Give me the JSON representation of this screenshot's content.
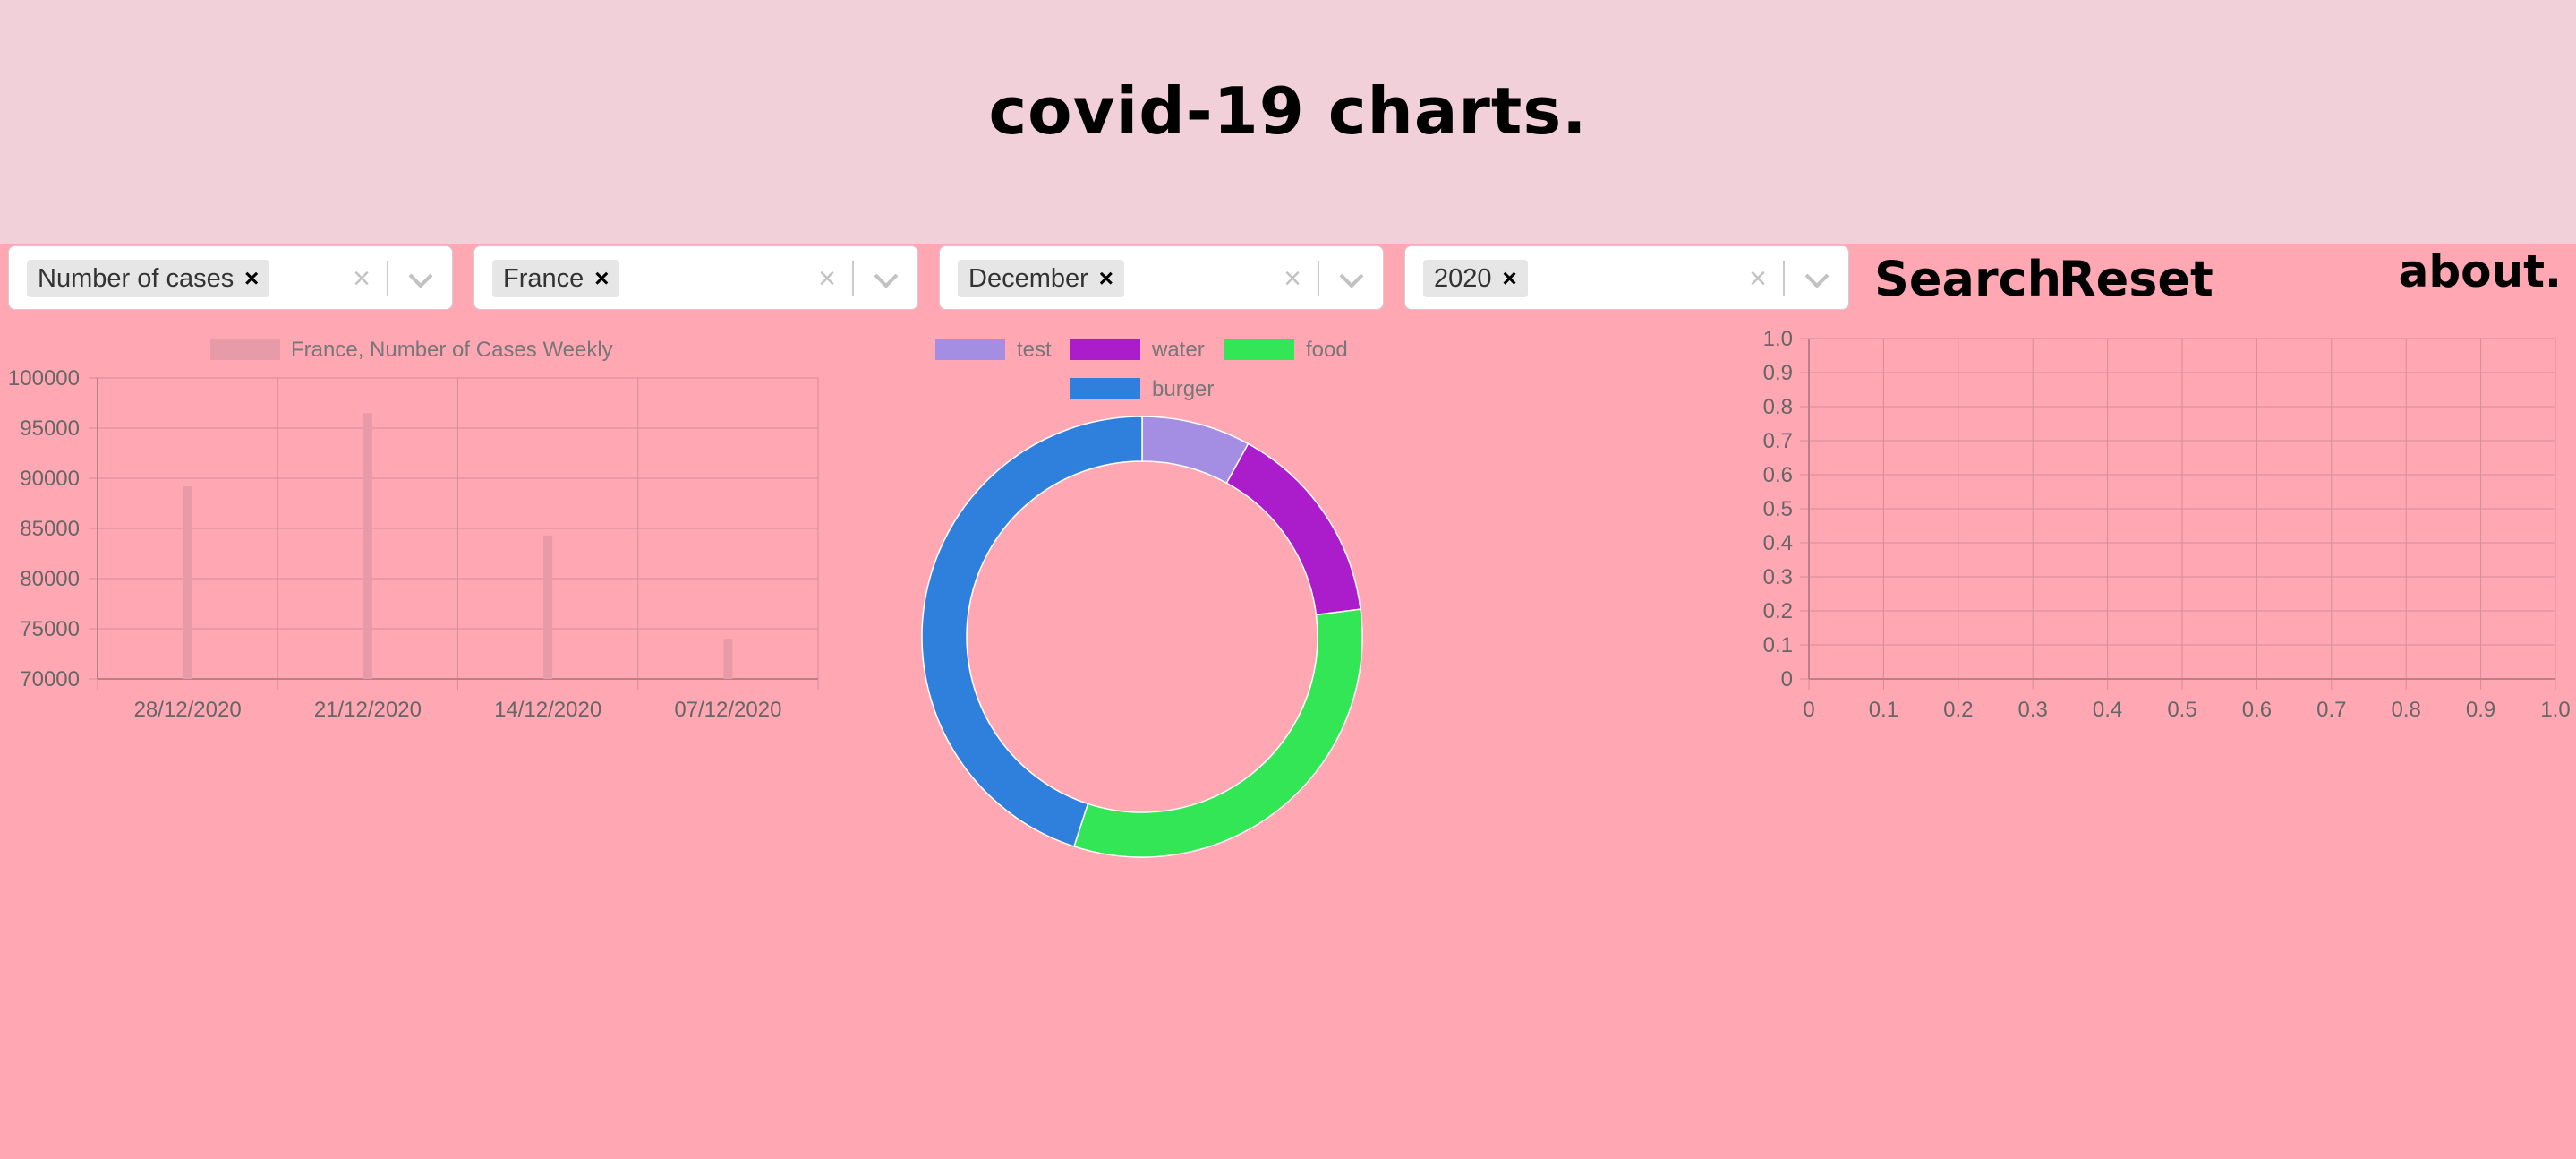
{
  "header": {
    "title": "covid-19 charts."
  },
  "filters": [
    {
      "selected": "Number of cases"
    },
    {
      "selected": "France"
    },
    {
      "selected": "December"
    },
    {
      "selected": "2020"
    }
  ],
  "actions": {
    "search_label": "Search",
    "reset_label": "Reset",
    "about_label": "about."
  },
  "icons": {
    "remove": "close-icon",
    "clear": "clear-icon",
    "dropdown": "chevron-down-icon"
  },
  "chart_data": [
    {
      "type": "bar",
      "legend": [
        "France, Number of Cases Weekly"
      ],
      "categories": [
        "28/12/2020",
        "21/12/2020",
        "14/12/2020",
        "07/12/2020"
      ],
      "series": [
        {
          "name": "France, Number of Cases Weekly",
          "values": [
            89200,
            96500,
            84300,
            74000
          ],
          "color": "#e79aa8"
        }
      ],
      "ylim": [
        70000,
        100000
      ],
      "yticks": [
        100000,
        95000,
        90000,
        85000,
        80000,
        75000,
        70000
      ],
      "grid": true,
      "legend_position": "top"
    },
    {
      "type": "pie",
      "donut": true,
      "labels": [
        "test",
        "water",
        "food",
        "burger"
      ],
      "values": [
        8,
        15,
        32,
        45
      ],
      "colors": [
        "#a38ee4",
        "#ab1dcb",
        "#33e655",
        "#2f7fdc"
      ],
      "legend_position": "top"
    },
    {
      "type": "scatter",
      "xlim": [
        0,
        1.0
      ],
      "ylim": [
        0,
        1.0
      ],
      "xticks": [
        "0",
        "0.1",
        "0.2",
        "0.3",
        "0.4",
        "0.5",
        "0.6",
        "0.7",
        "0.8",
        "0.9",
        "1.0"
      ],
      "yticks": [
        "1.0",
        "0.9",
        "0.8",
        "0.7",
        "0.6",
        "0.5",
        "0.4",
        "0.3",
        "0.2",
        "0.1",
        "0"
      ],
      "points": [],
      "grid": true
    }
  ]
}
